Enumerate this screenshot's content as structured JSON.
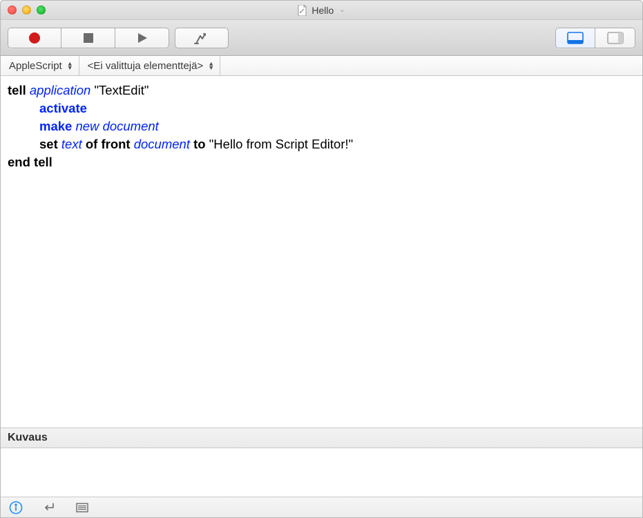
{
  "window_title": "Hello",
  "nav": {
    "language_label": "AppleScript",
    "selection_label": "<Ei valittuja elementtejä>"
  },
  "script": {
    "line1": {
      "tell": "tell",
      "application": "application",
      "app_name": "\"TextEdit\""
    },
    "line2": {
      "activate": "activate"
    },
    "line3": {
      "make": "make",
      "new": "new",
      "document": "document"
    },
    "line4": {
      "set": "set",
      "text": "text",
      "of": "of",
      "front": "front",
      "document": "document",
      "to": "to",
      "value": "\"Hello from Script Editor!\""
    },
    "line5": {
      "end_tell": "end tell"
    }
  },
  "description_header": "Kuvaus"
}
